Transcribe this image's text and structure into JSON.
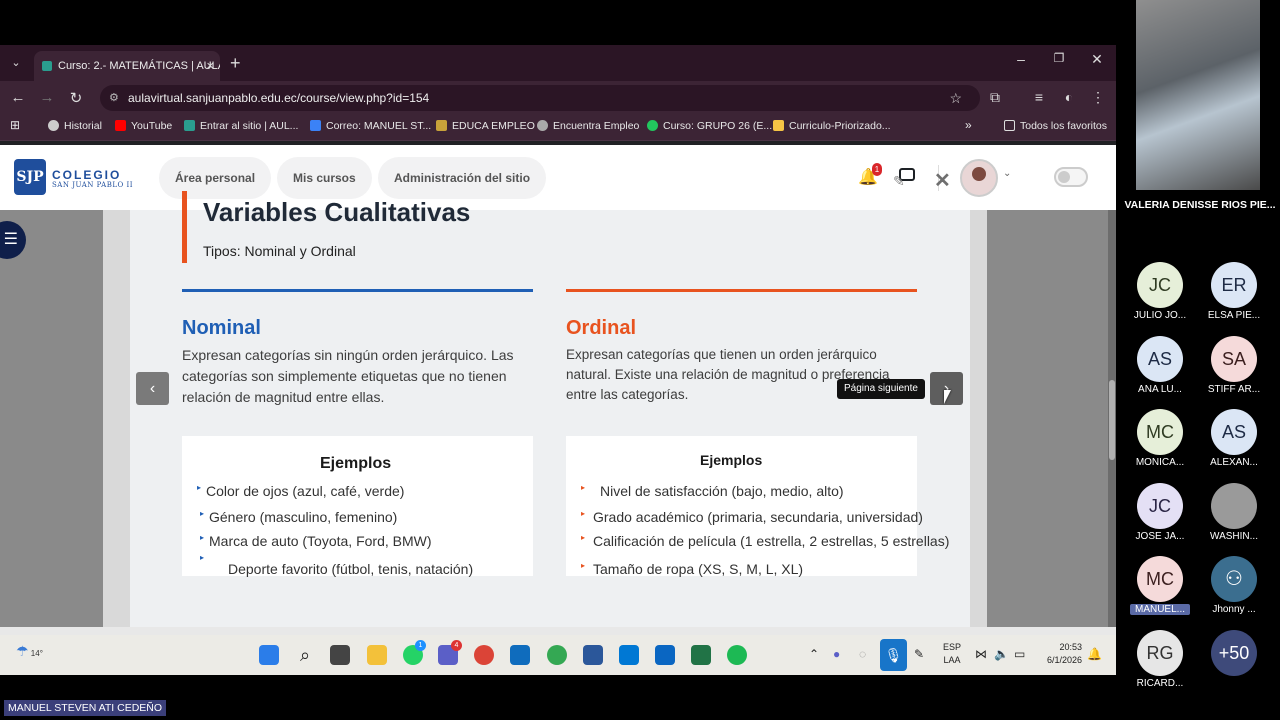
{
  "browser": {
    "tab_title": "Curso: 2.- MATEMÁTICAS | AULA",
    "url": "aulavirtual.sanjuanpablo.edu.ec/course/view.php?id=154",
    "bookmarks": [
      {
        "label": "Historial",
        "color": "#cccccc"
      },
      {
        "label": "YouTube",
        "color": "#ff0000"
      },
      {
        "label": "Entrar al sitio | AUL...",
        "color": "#2a9d8f"
      },
      {
        "label": "Correo: MANUEL ST...",
        "color": "#3b82f6"
      },
      {
        "label": "EDUCA EMPLEO",
        "color": "#c8a23a"
      },
      {
        "label": "Encuentra Empleo",
        "color": "#aaaaaa"
      },
      {
        "label": "Curso: GRUPO 26 (E...",
        "color": "#22c55e"
      },
      {
        "label": "Curriculo-Priorizado...",
        "color": "#f6c445"
      }
    ],
    "all_favorites": "Todos los favoritos"
  },
  "site": {
    "logo_line1": "COLEGIO",
    "logo_line2": "SAN JUAN PABLO II",
    "logo_mark": "SJP",
    "nav": [
      "Área personal",
      "Mis cursos",
      "Administración del sitio"
    ],
    "notification_count": "1"
  },
  "slide": {
    "title": "Variables Cualitativas",
    "subtitle": "Tipos: Nominal y Ordinal",
    "nominal": {
      "heading": "Nominal",
      "color": "#1f5fb5",
      "text": "Expresan categorías sin ningún orden jerárquico. Las categorías son simplemente etiquetas que no tienen relación de magnitud entre ellas.",
      "examples_heading": "Ejemplos",
      "examples": [
        "Color de ojos (azul, café, verde)",
        "Género (masculino, femenino)",
        "Marca de auto (Toyota, Ford, BMW)",
        "Deporte favorito (fútbol, tenis, natación)"
      ]
    },
    "ordinal": {
      "heading": "Ordinal",
      "color": "#e8531f",
      "text": "Expresan categorías que tienen un orden jerárquico natural. Existe una relación de magnitud o preferencia entre las categorías.",
      "examples_heading": "Ejemplos",
      "examples": [
        "Nivel de satisfacción (bajo, medio, alto)",
        "Grado académico (primaria, secundaria, universidad)",
        "Calificación de película (1 estrella, 2 estrellas, 5 estrellas)",
        "Tamaño de ropa (XS, S, M, L, XL)"
      ]
    },
    "tooltip": "Página siguiente",
    "prev_glyph": "‹",
    "next_glyph": "›"
  },
  "taskbar": {
    "temperature": "14°",
    "lang_line1": "ESP",
    "lang_line2": "LAA",
    "time": "20:53",
    "date": "6/1/2026",
    "whatsapp_badge": "1",
    "teams_badge": "4"
  },
  "meeting": {
    "speaker": "VALERIA DENISSE RIOS PIE...",
    "participants": [
      {
        "initials": "JC",
        "name": "JULIO JO...",
        "bg": "#e6efd9",
        "fg": "#2f3b22"
      },
      {
        "initials": "ER",
        "name": "ELSA PIE...",
        "bg": "#dbe6f5",
        "fg": "#1e2b45"
      },
      {
        "initials": "AS",
        "name": "ANA LU...",
        "bg": "#dbe6f5",
        "fg": "#1e2b45"
      },
      {
        "initials": "SA",
        "name": "STIFF AR...",
        "bg": "#f5dada",
        "fg": "#3b1f1f"
      },
      {
        "initials": "MC",
        "name": "MONICA...",
        "bg": "#e6efd9",
        "fg": "#2f3b22"
      },
      {
        "initials": "AS",
        "name": "ALEXAN...",
        "bg": "#dbe6f5",
        "fg": "#1e2b45"
      },
      {
        "initials": "JC",
        "name": "JOSE JA...",
        "bg": "#e4e0f5",
        "fg": "#2a2545"
      },
      {
        "initials": "",
        "name": "WASHIN...",
        "bg": "#9a9a9a",
        "fg": "#ffffff"
      },
      {
        "initials": "MC",
        "name": "MANUEL...",
        "bg": "#f5dada",
        "fg": "#3b1f1f"
      },
      {
        "initials": "",
        "name": "Jhonny ...",
        "bg": "#3b6e8f",
        "fg": "#ffffff"
      },
      {
        "initials": "RG",
        "name": "RICARD...",
        "bg": "#e6e6e6",
        "fg": "#333333"
      },
      {
        "initials": "+50",
        "name": "",
        "bg": "#3e4a7a",
        "fg": "#ffffff"
      }
    ],
    "self_name": "MANUEL STEVEN ATI CEDEÑO"
  }
}
